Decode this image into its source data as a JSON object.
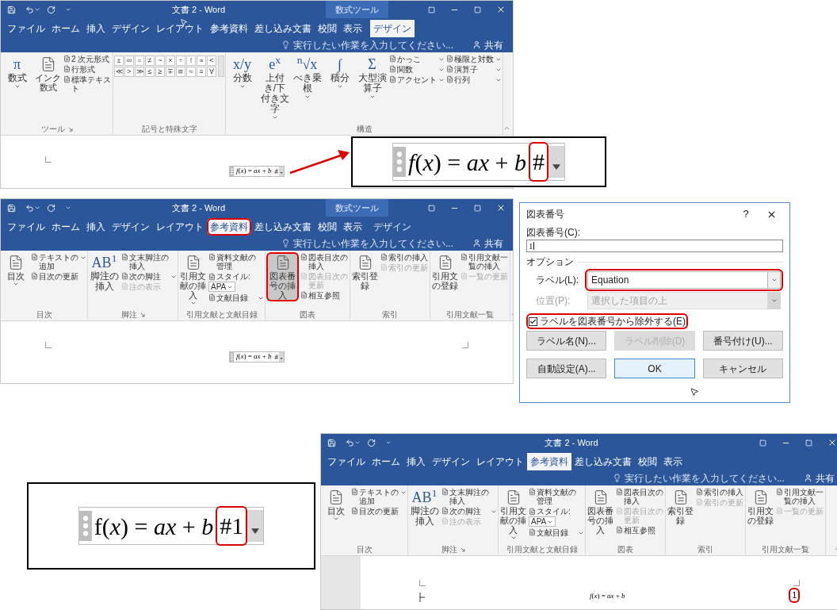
{
  "windows": [
    {
      "title": "文書 2 - Word",
      "context_tab": "数式ツール",
      "tabs": [
        {
          "label": "ファイル",
          "kind": "normal",
          "selected": false,
          "highlighted": false
        },
        {
          "label": "ホーム",
          "kind": "normal",
          "selected": false,
          "highlighted": false
        },
        {
          "label": "挿入",
          "kind": "normal",
          "selected": false,
          "highlighted": false
        },
        {
          "label": "デザイン",
          "kind": "normal",
          "selected": false,
          "highlighted": false
        },
        {
          "label": "レイアウト",
          "kind": "normal",
          "selected": false,
          "highlighted": false
        },
        {
          "label": "参考資料",
          "kind": "normal",
          "selected": false,
          "highlighted": false
        },
        {
          "label": "差し込み文書",
          "kind": "normal",
          "selected": false,
          "highlighted": false
        },
        {
          "label": "校閲",
          "kind": "normal",
          "selected": false,
          "highlighted": false
        },
        {
          "label": "表示",
          "kind": "normal",
          "selected": false,
          "highlighted": false
        },
        {
          "label": "デザイン",
          "kind": "context",
          "selected": true,
          "highlighted": false
        }
      ],
      "tell_me": "実行したい作業を入力してください...",
      "share": "共有",
      "ribbon": [
        {
          "label": "ツール",
          "launcher": true,
          "items": [
            {
              "kind": "large",
              "glyph": "π",
              "label": "数式",
              "dropdown": true,
              "highlighted": false
            },
            {
              "kind": "large",
              "label": "インク数式",
              "dropdown": false,
              "highlighted": false
            },
            {
              "kind": "column",
              "items": [
                {
                  "label": "2 次元形式",
                  "dropdown": false,
                  "disabled": false
                },
                {
                  "label": "行形式",
                  "dropdown": false,
                  "disabled": false
                },
                {
                  "label": "標準テキスト",
                  "dropdown": false,
                  "disabled": false
                }
              ]
            }
          ]
        },
        {
          "label": "記号と特殊文字",
          "launcher": false,
          "items": [
            {
              "kind": "symbols",
              "symbols": [
                "±",
                "∞",
                "=",
                "≠",
                "~",
                "×",
                "÷",
                "!",
                "∝",
                "<",
                "≪",
                ">",
                "≫",
                "≤",
                "≥",
                "∓",
                "≅",
                "≈",
                "≡",
                "∀"
              ]
            }
          ]
        },
        {
          "label": "構造",
          "launcher": false,
          "items": [
            {
              "kind": "large",
              "glyph": "x/y",
              "label": "分数",
              "dropdown": true,
              "highlighted": false
            },
            {
              "kind": "large",
              "glyph": "e$^{x}$",
              "label": "上付き/下付き文字",
              "dropdown": true,
              "highlighted": false
            },
            {
              "kind": "large",
              "glyph": "$^{n}$√x",
              "label": "べき乗根",
              "dropdown": true,
              "highlighted": false
            },
            {
              "kind": "large",
              "glyph": "∫",
              "label": "積分",
              "dropdown": true,
              "highlighted": false
            },
            {
              "kind": "large",
              "glyph": "Σ",
              "label": "大型演算子",
              "dropdown": true,
              "highlighted": false
            },
            {
              "kind": "column",
              "items": [
                {
                  "label": "かっこ",
                  "dropdown": true,
                  "disabled": false
                },
                {
                  "label": "関数",
                  "dropdown": true,
                  "disabled": false
                },
                {
                  "label": "アクセント",
                  "dropdown": true,
                  "disabled": false
                }
              ]
            },
            {
              "kind": "column",
              "items": [
                {
                  "label": "極限と対数",
                  "dropdown": true,
                  "disabled": false
                },
                {
                  "label": "演算子",
                  "dropdown": true,
                  "disabled": false
                },
                {
                  "label": "行列",
                  "dropdown": true,
                  "disabled": false
                }
              ]
            }
          ]
        }
      ],
      "document": {
        "kind": "inline",
        "equation": "*f*(*x*) = *ax* + *b*",
        "marker": "#",
        "highlighted": false
      }
    },
    {
      "title": "文書 2 - Word",
      "context_tab": "数式ツール",
      "tabs": [
        {
          "label": "ファイル",
          "kind": "normal",
          "selected": false,
          "highlighted": false
        },
        {
          "label": "ホーム",
          "kind": "normal",
          "selected": false,
          "highlighted": false
        },
        {
          "label": "挿入",
          "kind": "normal",
          "selected": false,
          "highlighted": false
        },
        {
          "label": "デザイン",
          "kind": "normal",
          "selected": false,
          "highlighted": false
        },
        {
          "label": "レイアウト",
          "kind": "normal",
          "selected": false,
          "highlighted": false
        },
        {
          "label": "参考資料",
          "kind": "normal",
          "selected": true,
          "highlighted": true
        },
        {
          "label": "差し込み文書",
          "kind": "normal",
          "selected": false,
          "highlighted": false
        },
        {
          "label": "校閲",
          "kind": "normal",
          "selected": false,
          "highlighted": false
        },
        {
          "label": "表示",
          "kind": "normal",
          "selected": false,
          "highlighted": false
        },
        {
          "label": "デザイン",
          "kind": "context",
          "selected": false,
          "highlighted": false
        }
      ],
      "tell_me": "実行したい作業を入力してください...",
      "share": "共有",
      "ribbon": [
        {
          "label": "目次",
          "launcher": false,
          "items": [
            {
              "kind": "large",
              "label": "目次",
              "dropdown": true,
              "highlighted": false
            },
            {
              "kind": "column",
              "items": [
                {
                  "label": "テキストの追加",
                  "dropdown": true,
                  "disabled": false
                },
                {
                  "label": "目次の更新",
                  "dropdown": false,
                  "disabled": false
                }
              ]
            }
          ]
        },
        {
          "label": "脚注",
          "launcher": true,
          "items": [
            {
              "kind": "large",
              "glyph": "AB$^{1}$",
              "label": "脚注の挿入",
              "dropdown": false,
              "highlighted": false
            },
            {
              "kind": "column",
              "items": [
                {
                  "label": "文末脚注の挿入",
                  "dropdown": false,
                  "disabled": false
                },
                {
                  "label": "次の脚注",
                  "dropdown": true,
                  "disabled": false
                },
                {
                  "label": "注の表示",
                  "dropdown": false,
                  "disabled": true
                }
              ]
            }
          ]
        },
        {
          "label": "引用文献と文献目録",
          "launcher": false,
          "items": [
            {
              "kind": "large",
              "label": "引用文献の挿入",
              "dropdown": true,
              "highlighted": false
            },
            {
              "kind": "column",
              "items": [
                {
                  "label": "資料文献の管理",
                  "dropdown": false,
                  "disabled": false
                },
                {
                  "label": "スタイル:",
                  "select": "APA",
                  "dropdown": true,
                  "disabled": false
                },
                {
                  "label": "文献目録",
                  "dropdown": true,
                  "disabled": false
                }
              ]
            }
          ]
        },
        {
          "label": "図表",
          "launcher": false,
          "items": [
            {
              "kind": "large",
              "label": "図表番号の挿入",
              "dropdown": false,
              "highlighted": true
            },
            {
              "kind": "column",
              "items": [
                {
                  "label": "図表目次の挿入",
                  "dropdown": false,
                  "disabled": false
                },
                {
                  "label": "図表目次の更新",
                  "dropdown": false,
                  "disabled": true
                },
                {
                  "label": "相互参照",
                  "dropdown": false,
                  "disabled": false
                }
              ]
            }
          ]
        },
        {
          "label": "索引",
          "launcher": false,
          "items": [
            {
              "kind": "large",
              "label": "索引登録",
              "dropdown": false,
              "highlighted": false
            },
            {
              "kind": "column",
              "items": [
                {
                  "label": "索引の挿入",
                  "dropdown": false,
                  "disabled": false
                },
                {
                  "label": "索引の更新",
                  "dropdown": false,
                  "disabled": true
                }
              ]
            }
          ]
        },
        {
          "label": "引用文献一覧",
          "launcher": false,
          "items": [
            {
              "kind": "large",
              "label": "引用文の登録",
              "dropdown": false,
              "highlighted": false
            },
            {
              "kind": "column",
              "items": [
                {
                  "label": "引用文献一覧の挿入",
                  "dropdown": false,
                  "disabled": false
                },
                {
                  "label": "一覧の更新",
                  "dropdown": false,
                  "disabled": true
                }
              ]
            }
          ]
        }
      ],
      "document": {
        "kind": "inline",
        "equation": "*f*(*x*) = *ax* + *b*",
        "marker": "#",
        "highlighted": false
      }
    },
    {
      "title": "文書 2 - Word",
      "tabs": [
        {
          "label": "ファイル",
          "kind": "normal",
          "selected": false,
          "highlighted": false
        },
        {
          "label": "ホーム",
          "kind": "normal",
          "selected": false,
          "highlighted": false
        },
        {
          "label": "挿入",
          "kind": "normal",
          "selected": false,
          "highlighted": false
        },
        {
          "label": "デザイン",
          "kind": "normal",
          "selected": false,
          "highlighted": false
        },
        {
          "label": "レイアウト",
          "kind": "normal",
          "selected": false,
          "highlighted": false
        },
        {
          "label": "参考資料",
          "kind": "normal",
          "selected": true,
          "highlighted": false
        },
        {
          "label": "差し込み文書",
          "kind": "normal",
          "selected": false,
          "highlighted": false
        },
        {
          "label": "校閲",
          "kind": "normal",
          "selected": false,
          "highlighted": false
        },
        {
          "label": "表示",
          "kind": "normal",
          "selected": false,
          "highlighted": false
        }
      ],
      "tell_me": "実行したい作業を入力してください...",
      "share": "共有",
      "ribbon": [
        {
          "label": "目次",
          "launcher": false,
          "items": [
            {
              "kind": "large",
              "label": "目次",
              "dropdown": true,
              "highlighted": false
            },
            {
              "kind": "column",
              "items": [
                {
                  "label": "テキストの追加",
                  "dropdown": true,
                  "disabled": false
                },
                {
                  "label": "目次の更新",
                  "dropdown": false,
                  "disabled": false
                }
              ]
            }
          ]
        },
        {
          "label": "脚注",
          "launcher": true,
          "items": [
            {
              "kind": "large",
              "glyph": "AB$^{1}$",
              "label": "脚注の挿入",
              "dropdown": false,
              "highlighted": false
            },
            {
              "kind": "column",
              "items": [
                {
                  "label": "文末脚注の挿入",
                  "dropdown": false,
                  "disabled": false
                },
                {
                  "label": "次の脚注",
                  "dropdown": true,
                  "disabled": false
                },
                {
                  "label": "注の表示",
                  "dropdown": false,
                  "disabled": true
                }
              ]
            }
          ]
        },
        {
          "label": "引用文献と文献目録",
          "launcher": false,
          "items": [
            {
              "kind": "large",
              "label": "引用文献の挿入",
              "dropdown": true,
              "highlighted": false
            },
            {
              "kind": "column",
              "items": [
                {
                  "label": "資料文献の管理",
                  "dropdown": false,
                  "disabled": false
                },
                {
                  "label": "スタイル:",
                  "select": "APA",
                  "dropdown": true,
                  "disabled": false
                },
                {
                  "label": "文献目録",
                  "dropdown": true,
                  "disabled": false
                }
              ]
            }
          ]
        },
        {
          "label": "図表",
          "launcher": false,
          "items": [
            {
              "kind": "large",
              "label": "図表番号の挿入",
              "dropdown": false,
              "highlighted": false
            },
            {
              "kind": "column",
              "items": [
                {
                  "label": "図表目次の挿入",
                  "dropdown": false,
                  "disabled": false
                },
                {
                  "label": "図表目次の更新",
                  "dropdown": false,
                  "disabled": true
                },
                {
                  "label": "相互参照",
                  "dropdown": false,
                  "disabled": false
                }
              ]
            }
          ]
        },
        {
          "label": "索引",
          "launcher": false,
          "items": [
            {
              "kind": "large",
              "label": "索引登録",
              "dropdown": false,
              "highlighted": false
            },
            {
              "kind": "column",
              "items": [
                {
                  "label": "索引の挿入",
                  "dropdown": false,
                  "disabled": false
                },
                {
                  "label": "索引の更新",
                  "dropdown": false,
                  "disabled": true
                }
              ]
            }
          ]
        },
        {
          "label": "引用文献一覧",
          "launcher": false,
          "items": [
            {
              "kind": "large",
              "label": "引用文の登録",
              "dropdown": false,
              "highlighted": false
            },
            {
              "kind": "column",
              "items": [
                {
                  "label": "引用文献一覧の挿入",
                  "dropdown": false,
                  "disabled": false
                },
                {
                  "label": "一覧の更新",
                  "dropdown": false,
                  "disabled": true
                }
              ]
            }
          ]
        }
      ],
      "document": {
        "kind": "numbered",
        "equation": "*f*(*x*) = *ax* + *b*",
        "marker": "1",
        "highlighted": true
      }
    }
  ],
  "insets": [
    {
      "equation": "*f*(*x*) = *ax* + *b*",
      "marker": "#",
      "highlighted": true
    },
    {
      "equation": "f(*x*) = *ax* + *b*",
      "marker": "#1",
      "highlighted": true
    }
  ],
  "dialog": {
    "title": "図表番号",
    "help": "?",
    "caption_label": "図表番号(C):",
    "caption_value": "1",
    "options_label": "オプション",
    "label_field": {
      "label": "ラベル(L):",
      "value": "Equation",
      "disabled": false,
      "highlighted": true
    },
    "position_field": {
      "label": "位置(P):",
      "value": "選択した項目の上",
      "disabled": true,
      "highlighted": false
    },
    "exclude": {
      "label": "ラベルを図表番号から除外する(E)",
      "checked": true,
      "highlighted": true
    },
    "button_rows": [
      [
        {
          "label": "ラベル名(N)...",
          "disabled": false,
          "default": false
        },
        {
          "label": "ラベル削除(D)",
          "disabled": true,
          "default": false
        },
        {
          "label": "番号付け(U)...",
          "disabled": false,
          "default": false
        }
      ],
      [
        {
          "label": "自動設定(A)...",
          "disabled": false,
          "default": false
        },
        {
          "label": "OK",
          "disabled": false,
          "default": true
        },
        {
          "label": "キャンセル",
          "disabled": false,
          "default": false
        }
      ]
    ]
  }
}
